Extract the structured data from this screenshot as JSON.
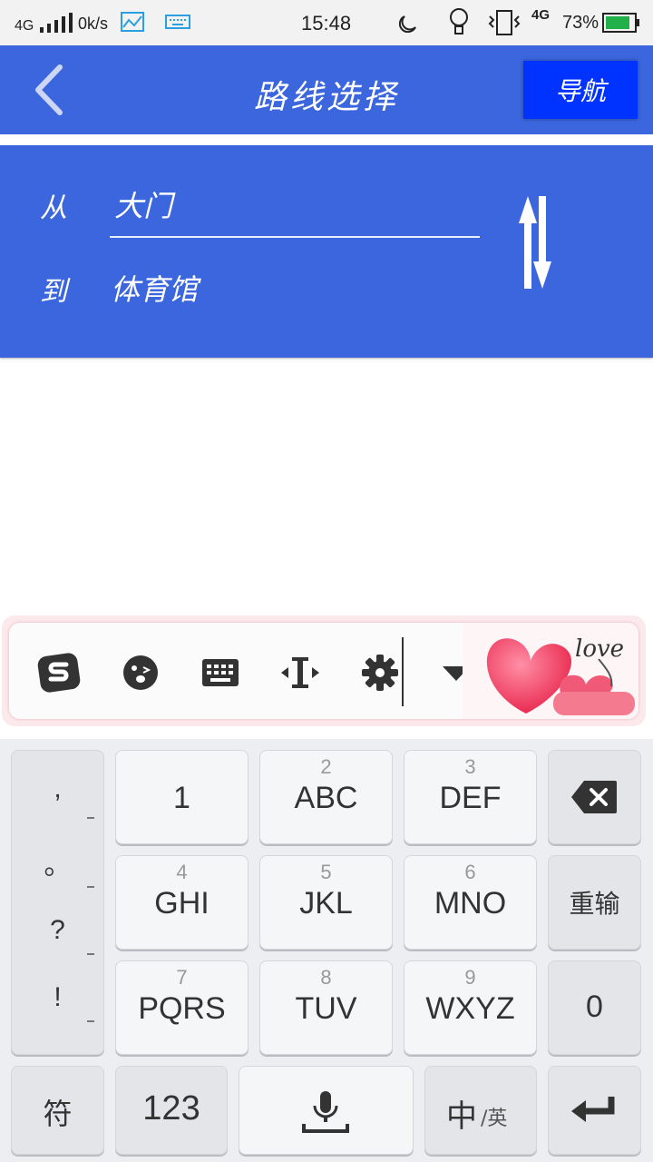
{
  "status": {
    "network_left": "4G",
    "speed": "0k/s",
    "time": "15:48",
    "network_right": "4G",
    "battery": "73%"
  },
  "titlebar": {
    "title": "路线选择",
    "nav_label": "导航"
  },
  "route": {
    "from_label": "从",
    "from_value": "大门",
    "to_label": "到",
    "to_value": "体育馆"
  },
  "ime_toolbar": {
    "love_text": "love"
  },
  "keyboard": {
    "punct": [
      ",",
      "。",
      "?",
      "!"
    ],
    "rows": [
      [
        {
          "num": "",
          "main": "1"
        },
        {
          "num": "2",
          "main": "ABC"
        },
        {
          "num": "3",
          "main": "DEF"
        }
      ],
      [
        {
          "num": "4",
          "main": "GHI"
        },
        {
          "num": "5",
          "main": "JKL"
        },
        {
          "num": "6",
          "main": "MNO"
        }
      ],
      [
        {
          "num": "7",
          "main": "PQRS"
        },
        {
          "num": "8",
          "main": "TUV"
        },
        {
          "num": "9",
          "main": "WXYZ"
        }
      ]
    ],
    "reinput": "重输",
    "zero": "0",
    "symbol": "符",
    "num_mode": "123",
    "lang_main": "中",
    "lang_sub": "/英"
  },
  "colors": {
    "header_blue": "#3b66de",
    "nav_button": "#0033ff"
  }
}
